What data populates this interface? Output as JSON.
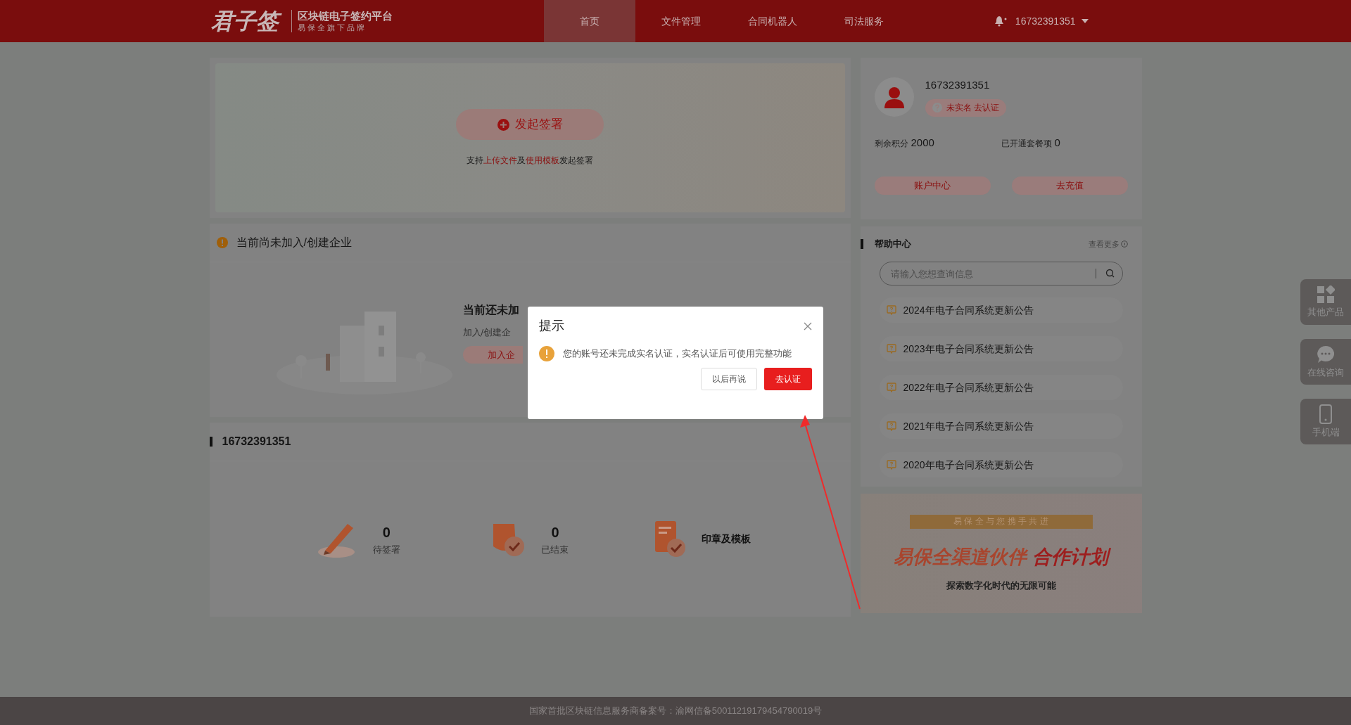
{
  "header": {
    "logo_script": "君子签",
    "logo_title": "区块链电子签约平台",
    "logo_subtitle": "易 保 全 旗 下 品 牌",
    "nav": [
      {
        "label": "首页",
        "selected": true
      },
      {
        "label": "文件管理",
        "selected": false
      },
      {
        "label": "合同机器人",
        "selected": false
      },
      {
        "label": "司法服务",
        "selected": false
      }
    ],
    "user": "16732391351"
  },
  "banner": {
    "button": "发起签署",
    "hint": [
      {
        "kind": "plain",
        "text": "支持"
      },
      {
        "kind": "link",
        "text": "上传文件"
      },
      {
        "kind": "plain",
        "text": "及"
      },
      {
        "kind": "link",
        "text": "使用模板"
      },
      {
        "kind": "plain",
        "text": "发起签署"
      }
    ]
  },
  "enterprise": {
    "title": "当前尚未加入/创建企业",
    "heading": "当前还未加",
    "subtitle": "加入/创建企",
    "button": "加入企"
  },
  "account": {
    "title": "16732391351",
    "stats": [
      {
        "kind": "count",
        "value": "0",
        "label": "待签署"
      },
      {
        "kind": "count",
        "value": "0",
        "label": "已结束"
      },
      {
        "kind": "link",
        "label": "印章及模板"
      }
    ]
  },
  "profile": {
    "phone": "16732391351",
    "badge": "未实名 去认证",
    "points_label": "剩余积分",
    "points": "2000",
    "packages_label": "已开通套餐项",
    "packages": "0",
    "buttons": [
      "账户中心",
      "去充值"
    ]
  },
  "help": {
    "title": "帮助中心",
    "more": "查看更多",
    "search_placeholder": "请输入您想查询信息",
    "items": [
      "2024年电子合同系统更新公告",
      "2023年电子合同系统更新公告",
      "2022年电子合同系统更新公告",
      "2021年电子合同系统更新公告",
      "2020年电子合同系统更新公告"
    ]
  },
  "promo": {
    "tagline": "易 保 全 与 您 携 手 共 进",
    "title": "易保全渠道伙伴",
    "title_accent": "合作计划",
    "subtitle": "探索数字化时代的无限可能"
  },
  "side_tools": [
    {
      "kind": "apps",
      "label": "其他产品"
    },
    {
      "kind": "chat",
      "label": "在线咨询"
    },
    {
      "kind": "phone",
      "label": "手机端"
    }
  ],
  "footer": "国家首批区块链信息服务商备案号：渝网信备50011219179454790019号",
  "dialog": {
    "title": "提示",
    "message": "您的账号还未完成实名认证，实名认证后可使用完整功能",
    "buttons": [
      {
        "kind": "secondary",
        "label": "以后再说"
      },
      {
        "kind": "primary",
        "label": "去认证"
      }
    ]
  }
}
